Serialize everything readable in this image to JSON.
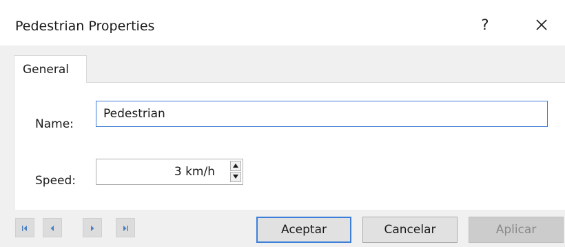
{
  "window": {
    "title": "Pedestrian Properties",
    "help_label": "?",
    "close_icon": "close-icon"
  },
  "tabs": [
    {
      "label": "General",
      "selected": true
    }
  ],
  "form": {
    "name_label": "Name:",
    "name_value": "Pedestrian",
    "speed_label": "Speed:",
    "speed_value": "3",
    "speed_unit": "km/h",
    "speed_display": "3  km/h"
  },
  "footer": {
    "nav_icons": [
      "first-record-icon",
      "previous-record-icon",
      "next-record-icon",
      "last-record-icon"
    ],
    "ok_label": "Aceptar",
    "cancel_label": "Cancelar",
    "apply_label": "Aplicar",
    "apply_enabled": false
  },
  "colors": {
    "focus_border": "#3a7bd5",
    "panel_background": "#f0f0f0",
    "button_face": "#e1e1e1",
    "disabled_text": "#8a8a8a"
  }
}
